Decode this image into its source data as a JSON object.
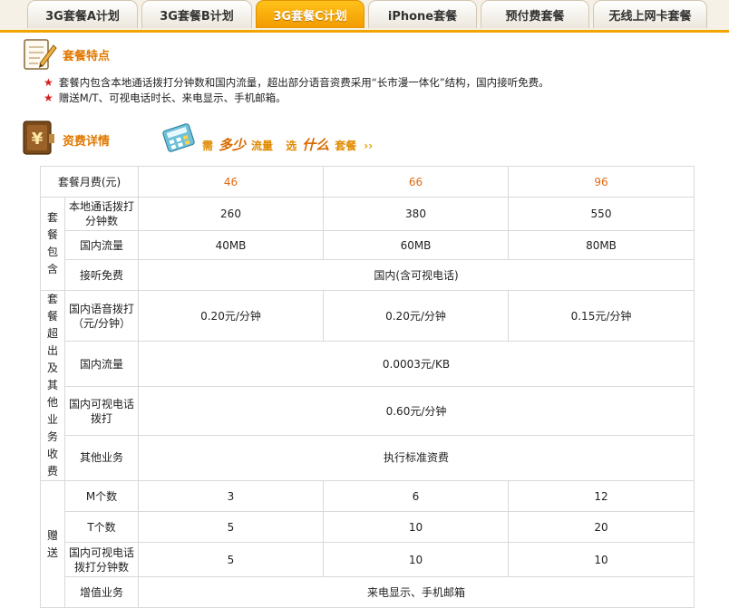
{
  "tabs": [
    {
      "label": "3G套餐A计划",
      "active": false
    },
    {
      "label": "3G套餐B计划",
      "active": false
    },
    {
      "label": "3G套餐C计划",
      "active": true
    },
    {
      "label": "iPhone套餐",
      "active": false
    },
    {
      "label": "预付费套餐",
      "active": false
    },
    {
      "label": "无线上网卡套餐",
      "active": false
    }
  ],
  "features": {
    "title": "套餐特点",
    "items": [
      "套餐内包含本地通话拨打分钟数和国内流量，超出部分语音资费采用“长市漫一体化”结构，国内接听免费。",
      "赠送M/T、可视电话时长、来电显示、手机邮箱。"
    ]
  },
  "pricing": {
    "title": "资费详情",
    "slogan": {
      "part1": "需",
      "part2": "多少",
      "part3": "流量",
      "part4": "选",
      "part5": "什么",
      "part6": "套餐",
      "arrow": "››"
    },
    "header": {
      "label": "套餐月费(元)",
      "plans": [
        "46",
        "66",
        "96"
      ]
    },
    "group_included": "套餐包含",
    "group_overage": "套餐超出及其他业务收费",
    "group_gift": "赠送",
    "rows": {
      "local_minutes": {
        "label": "本地通话拨打分钟数",
        "values": [
          "260",
          "380",
          "550"
        ]
      },
      "domestic_data": {
        "label": "国内流量",
        "values": [
          "40MB",
          "60MB",
          "80MB"
        ]
      },
      "incoming_free": {
        "label": "接听免费",
        "value": "国内(含可视电话)"
      },
      "voice_rate": {
        "label": "国内语音拨打（元/分钟）",
        "values": [
          "0.20元/分钟",
          "0.20元/分钟",
          "0.15元/分钟"
        ]
      },
      "data_rate": {
        "label": "国内流量",
        "value": "0.0003元/KB"
      },
      "video_call_rate": {
        "label": "国内可视电话拨打",
        "value": "0.60元/分钟"
      },
      "other_services": {
        "label": "其他业务",
        "value": "执行标准资费"
      },
      "m_count": {
        "label": "M个数",
        "values": [
          "3",
          "6",
          "12"
        ]
      },
      "t_count": {
        "label": "T个数",
        "values": [
          "5",
          "10",
          "20"
        ]
      },
      "video_minutes": {
        "label": "国内可视电话拨打分钟数",
        "values": [
          "5",
          "10",
          "10"
        ]
      },
      "value_added": {
        "label": "增值业务",
        "value": "来电显示、手机邮箱"
      }
    }
  },
  "colors": {
    "accent": "#f29a00",
    "price": "#e36a13",
    "heading": "#e07800",
    "star": "#d32020"
  },
  "icons": [
    "notepad-icon",
    "money-icon",
    "calculator-icon",
    "star-icon"
  ]
}
